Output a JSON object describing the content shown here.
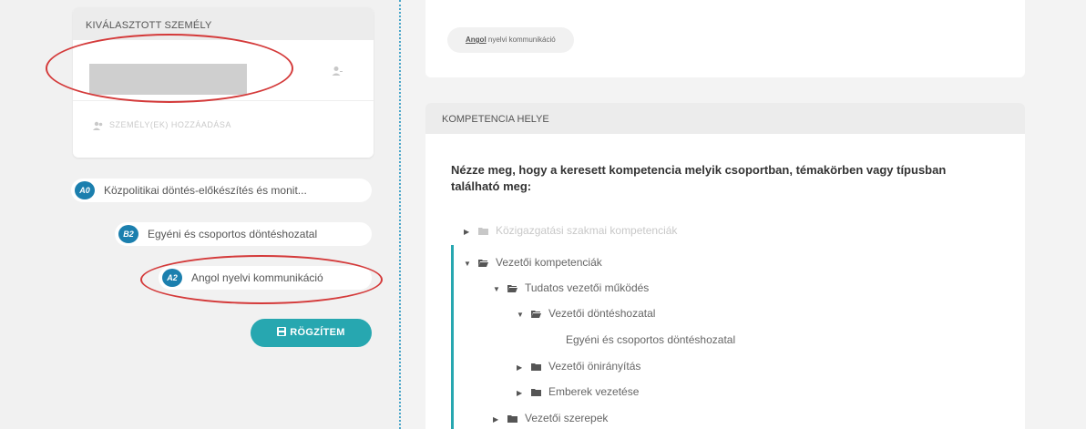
{
  "person_panel": {
    "header": "KIVÁLASZTOTT SZEMÉLY",
    "add_person_label": "SZEMÉLY(EK) HOZZÁADÁSA"
  },
  "breadcrumbs": [
    {
      "badge": "A0",
      "label": "Közpolitikai döntés-előkészítés és monit..."
    },
    {
      "badge": "B2",
      "label": "Egyéni és csoportos döntéshozatal"
    },
    {
      "badge": "A2",
      "label": "Angol nyelvi kommunikáció"
    }
  ],
  "save_button": {
    "label": "RÖGZÍTEM"
  },
  "top_card": {
    "tag_bold": "Angol",
    "tag_text": " nyelvi kommunikáció"
  },
  "competency_panel": {
    "header": "KOMPETENCIA HELYE",
    "instruction": "Nézze meg, hogy a keresett kompetencia melyik csoportban, témakörben vagy típusban található meg:",
    "tree": [
      {
        "label": "Közigazgatási szakmai kompetenciák",
        "state": "collapsed",
        "disabled": true
      },
      {
        "label": "Vezetői kompetenciák",
        "state": "expanded",
        "disabled": false
      },
      {
        "label": "Tudatos vezetői működés",
        "state": "expanded",
        "disabled": false
      },
      {
        "label": "Vezetői döntéshozatal",
        "state": "expanded",
        "disabled": false
      },
      {
        "label": "Egyéni és csoportos döntéshozatal",
        "state": "leaf",
        "disabled": false
      },
      {
        "label": "Vezetői önirányítás",
        "state": "collapsed",
        "disabled": false
      },
      {
        "label": "Emberek vezetése",
        "state": "collapsed",
        "disabled": false
      },
      {
        "label": "Vezetői szerepek",
        "state": "collapsed",
        "disabled": false
      }
    ]
  },
  "colors": {
    "accent": "#27a7b0",
    "badge": "#1b7fae",
    "annotation": "#d43a3a"
  }
}
